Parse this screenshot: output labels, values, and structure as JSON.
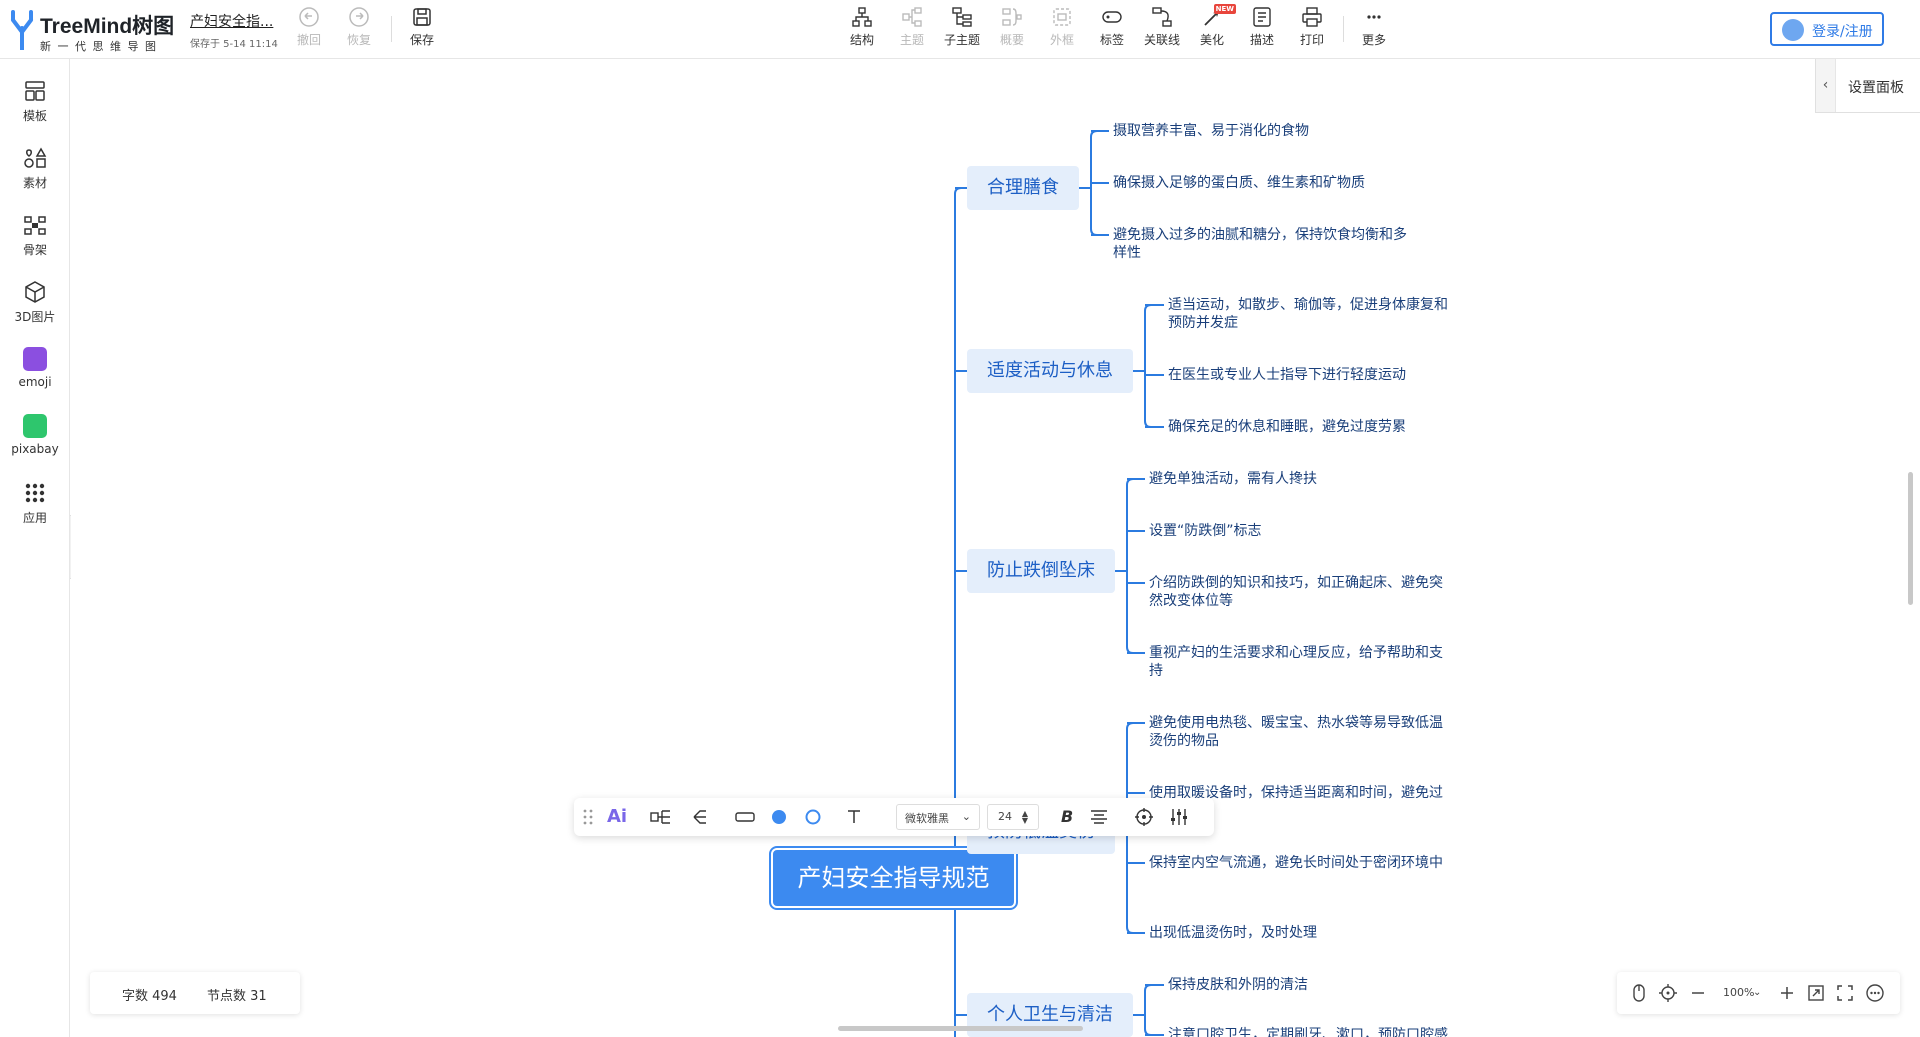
{
  "app": {
    "logo_name": "TreeMind树图",
    "logo_tagline": "新一代思维导图",
    "doc_title": "产妇安全指...",
    "saved_at": "保存于 5-14 11:14"
  },
  "toolbar_left": {
    "undo": "撤回",
    "redo": "恢复",
    "save": "保存"
  },
  "toolbar": {
    "structure": "结构",
    "topic": "主题",
    "subtopic": "子主题",
    "summary": "概要",
    "boundary": "外框",
    "label": "标签",
    "relation": "关联线",
    "beautify": "美化",
    "new_badge": "NEW",
    "describe": "描述",
    "print": "打印",
    "more": "更多"
  },
  "login_label": "登录/注册",
  "sidebar": {
    "template": "模板",
    "material": "素材",
    "skeleton": "骨架",
    "img3d": "3D图片",
    "emoji": "emoji",
    "pixabay": "pixabay",
    "apps": "应用"
  },
  "settings_panel_label": "设置面板",
  "mindmap": {
    "central": "产妇安全指导规范",
    "branches": [
      {
        "title": "合理膳食",
        "items": [
          "摄取营养丰富、易于消化的食物",
          "确保摄入足够的蛋白质、维生素和矿物质",
          "避免摄入过多的油腻和糖分，保持饮食均衡和多样性"
        ]
      },
      {
        "title": "适度活动与休息",
        "items": [
          "适当运动，如散步、瑜伽等，促进身体康复和预防并发症",
          "在医生或专业人士指导下进行轻度运动",
          "确保充足的休息和睡眠，避免过度劳累"
        ]
      },
      {
        "title": "防止跌倒坠床",
        "items": [
          "避免单独活动，需有人搀扶",
          "设置“防跌倒”标志",
          "介绍防跌倒的知识和技巧，如正确起床、避免突然改变体位等",
          "重视产妇的生活要求和心理反应，给予帮助和支持"
        ]
      },
      {
        "title": "预防低温烫伤",
        "items": [
          "避免使用电热毯、暖宝宝、热水袋等易导致低温烫伤的物品",
          "使用取暖设备时，保持适当距离和时间，避免过度依赖",
          "保持室内空气流通，避免长时间处于密闭环境中",
          "出现低温烫伤时，及时处理"
        ]
      },
      {
        "title": "个人卫生与清洁",
        "items": [
          "保持皮肤和外阴的清洁",
          "注意口腔卫生，定期刷牙、漱口，预防口腔感"
        ]
      }
    ]
  },
  "format_toolbar": {
    "ai_label": "Ai",
    "font_name": "微软雅黑",
    "font_size": "24",
    "bold_label": "B"
  },
  "status": {
    "char_count": "字数 494",
    "node_count": "节点数 31"
  },
  "zoom": {
    "level": "100%"
  },
  "colors": {
    "accent": "#2f7be6",
    "central_fill": "#3c8af0",
    "topic_fill": "#e4eefb",
    "topic_text": "#1d5fc5",
    "connector": "#2b7be0"
  }
}
